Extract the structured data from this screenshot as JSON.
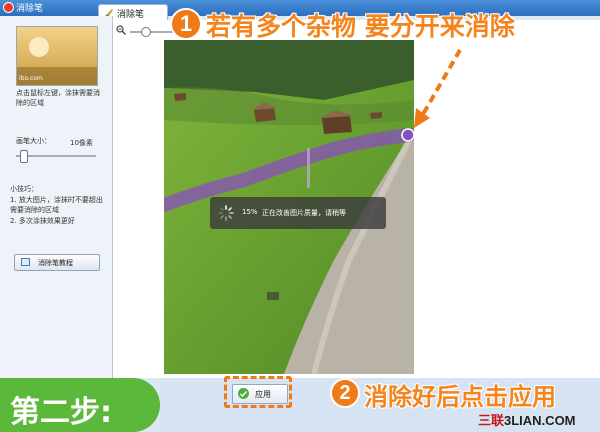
{
  "window": {
    "title": "消除笔"
  },
  "tab": {
    "label": "消除笔",
    "icon": "brush-icon"
  },
  "sidebar": {
    "thumbnail_caption": "ibo.com",
    "hint": "点击鼠标左键，涂抹需要消除的区域",
    "brush_size_label": "画笔大小：",
    "brush_size_value": "10像素",
    "tips_title": "小技巧：",
    "tips": [
      "1. 放大图片，涂抹时不要超出需要消除的区域",
      "2. 多次涂抹效果更好"
    ],
    "tutorial_button": "消除笔教程"
  },
  "progress": {
    "percent_text": "15%",
    "message": "正在改善图片质量，请稍等"
  },
  "callouts": {
    "step1_number": "1",
    "step1_text": "若有多个杂物 要分开来消除",
    "step2_number": "2",
    "step2_text": "消除好后点击应用"
  },
  "step_badge": "第二步:",
  "apply_button": "应用",
  "watermark": {
    "prefix": "三联",
    "suffix": "3LIAN.COM"
  },
  "colors": {
    "accent": "#f07a18",
    "brush": "#8a4fbf",
    "badge": "#5cb83a",
    "titlebar": "#2d6fc0"
  }
}
